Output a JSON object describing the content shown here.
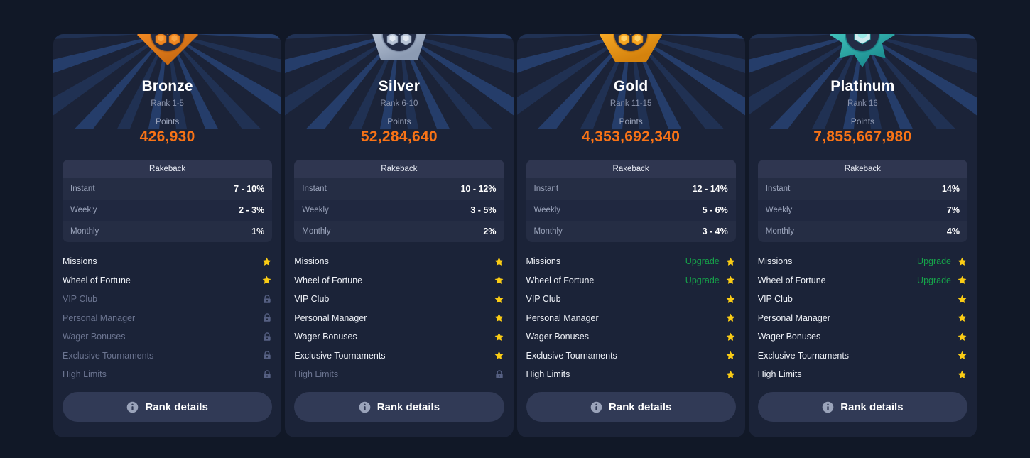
{
  "theme": {
    "page_bg": "#111827",
    "card_bg": "#1b2338",
    "accent_points": "#f97316",
    "upgrade_green": "#16a34a",
    "star_gold": "#facc15",
    "locked_gray": "#6b7490"
  },
  "common": {
    "rakeback_header": "Rakeback",
    "points_label": "Points",
    "rakeback_keys": [
      "Instant",
      "Weekly",
      "Monthly"
    ],
    "feature_names": [
      "Missions",
      "Wheel of Fortune",
      "VIP Club",
      "Personal Manager",
      "Wager Bonuses",
      "Exclusive Tournaments",
      "High Limits"
    ],
    "details_button_label": "Rank details",
    "upgrade_label": "Upgrade",
    "info_icon": "info-icon",
    "star_icon": "star-icon",
    "lock_icon": "lock-icon"
  },
  "cards": [
    {
      "name": "Bronze",
      "rank_range": "Rank 1-5",
      "points": "426,930",
      "badge_icon": "bronze-diamond-badge-icon",
      "badge_shape": "diamond",
      "badge_color_light": "#f9a94a",
      "badge_color_mid": "#ef8722",
      "badge_color_dark": "#c96a12",
      "ray_color": "#2a4a80",
      "rakeback": [
        "7 - 10%",
        "2 - 3%",
        "1%"
      ],
      "features": [
        {
          "label": "Missions",
          "unlocked": true,
          "upgrade": false
        },
        {
          "label": "Wheel of Fortune",
          "unlocked": true,
          "upgrade": false
        },
        {
          "label": "VIP Club",
          "unlocked": false,
          "upgrade": false
        },
        {
          "label": "Personal Manager",
          "unlocked": false,
          "upgrade": false
        },
        {
          "label": "Wager Bonuses",
          "unlocked": false,
          "upgrade": false
        },
        {
          "label": "Exclusive Tournaments",
          "unlocked": false,
          "upgrade": false
        },
        {
          "label": "High Limits",
          "unlocked": false,
          "upgrade": false
        }
      ]
    },
    {
      "name": "Silver",
      "rank_range": "Rank 6-10",
      "points": "52,284,640",
      "badge_icon": "silver-pentagon-badge-icon",
      "badge_shape": "pentagon",
      "badge_color_light": "#eaf0f7",
      "badge_color_mid": "#b8c4d6",
      "badge_color_dark": "#8c9bb3",
      "ray_color": "#2a4a80",
      "rakeback": [
        "10 - 12%",
        "3 - 5%",
        "2%"
      ],
      "features": [
        {
          "label": "Missions",
          "unlocked": true,
          "upgrade": false
        },
        {
          "label": "Wheel of Fortune",
          "unlocked": true,
          "upgrade": false
        },
        {
          "label": "VIP Club",
          "unlocked": true,
          "upgrade": false
        },
        {
          "label": "Personal Manager",
          "unlocked": true,
          "upgrade": false
        },
        {
          "label": "Wager Bonuses",
          "unlocked": true,
          "upgrade": false
        },
        {
          "label": "Exclusive Tournaments",
          "unlocked": true,
          "upgrade": false
        },
        {
          "label": "High Limits",
          "unlocked": false,
          "upgrade": false
        }
      ]
    },
    {
      "name": "Gold",
      "rank_range": "Rank 11-15",
      "points": "4,353,692,340",
      "badge_icon": "gold-hexagon-badge-icon",
      "badge_shape": "hexagon",
      "badge_color_light": "#ffd877",
      "badge_color_mid": "#f5a623",
      "badge_color_dark": "#d4820d",
      "ray_color": "#2a4a80",
      "rakeback": [
        "12 - 14%",
        "5 - 6%",
        "3 - 4%"
      ],
      "features": [
        {
          "label": "Missions",
          "unlocked": true,
          "upgrade": true
        },
        {
          "label": "Wheel of Fortune",
          "unlocked": true,
          "upgrade": true
        },
        {
          "label": "VIP Club",
          "unlocked": true,
          "upgrade": false
        },
        {
          "label": "Personal Manager",
          "unlocked": true,
          "upgrade": false
        },
        {
          "label": "Wager Bonuses",
          "unlocked": true,
          "upgrade": false
        },
        {
          "label": "Exclusive Tournaments",
          "unlocked": true,
          "upgrade": false
        },
        {
          "label": "High Limits",
          "unlocked": true,
          "upgrade": false
        }
      ]
    },
    {
      "name": "Platinum",
      "rank_range": "Rank 16",
      "points": "7,855,667,980",
      "badge_icon": "platinum-star-badge-icon",
      "badge_shape": "star8",
      "badge_color_light": "#8ee8e4",
      "badge_color_mid": "#3fbfb8",
      "badge_color_dark": "#1d8f92",
      "ray_color": "#2a4a80",
      "rakeback": [
        "14%",
        "7%",
        "4%"
      ],
      "features": [
        {
          "label": "Missions",
          "unlocked": true,
          "upgrade": true
        },
        {
          "label": "Wheel of Fortune",
          "unlocked": true,
          "upgrade": true
        },
        {
          "label": "VIP Club",
          "unlocked": true,
          "upgrade": false
        },
        {
          "label": "Personal Manager",
          "unlocked": true,
          "upgrade": false
        },
        {
          "label": "Wager Bonuses",
          "unlocked": true,
          "upgrade": false
        },
        {
          "label": "Exclusive Tournaments",
          "unlocked": true,
          "upgrade": false
        },
        {
          "label": "High Limits",
          "unlocked": true,
          "upgrade": false
        }
      ]
    }
  ]
}
